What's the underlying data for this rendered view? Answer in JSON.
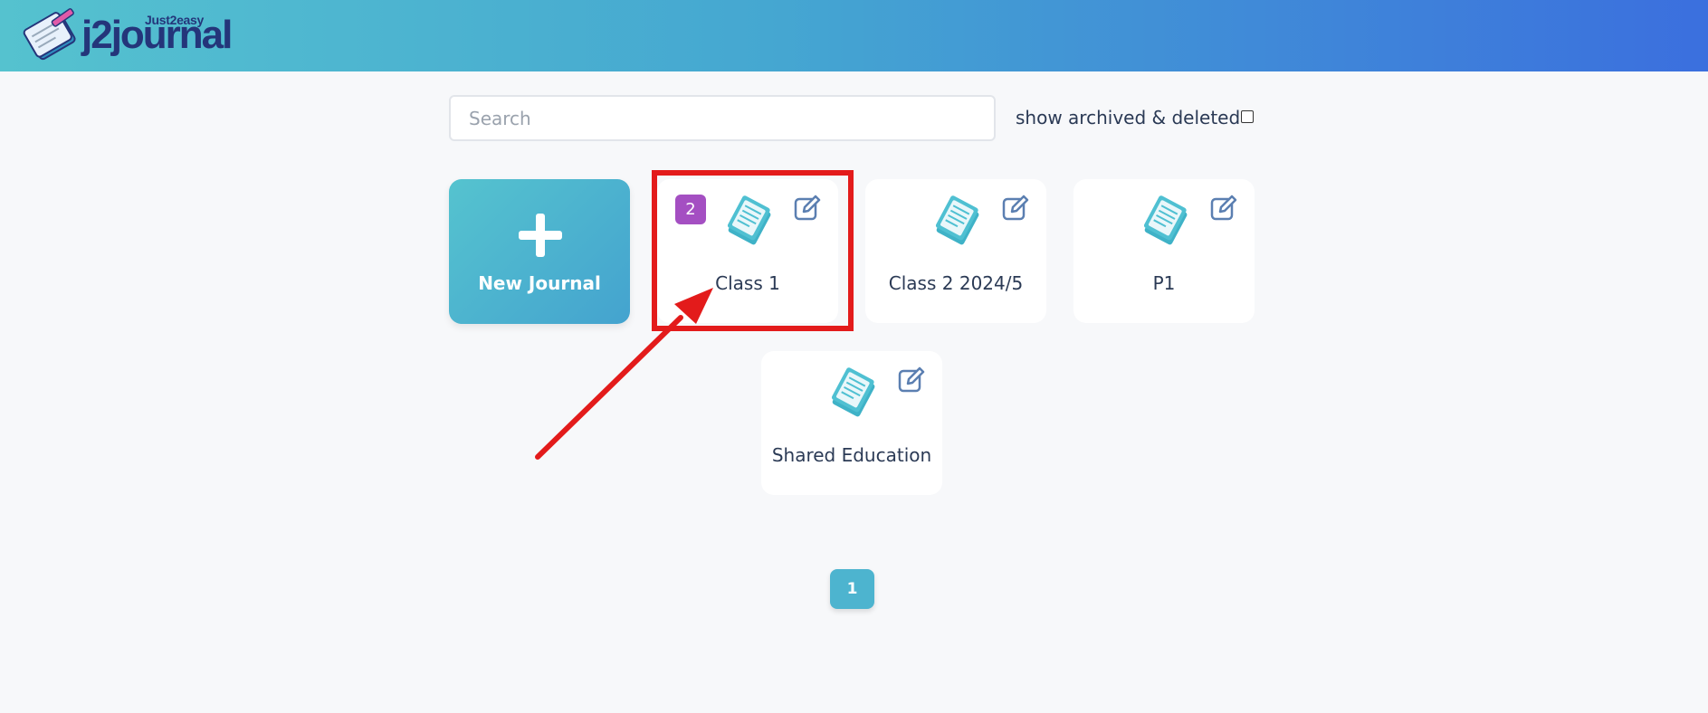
{
  "header": {
    "logo_small_text": "Just2easy",
    "logo_text": "j2journal"
  },
  "search": {
    "placeholder": "Search",
    "value": ""
  },
  "filters": {
    "archived_label": "show archived & deleted",
    "archived_checked": false
  },
  "new_journal": {
    "label": "New Journal"
  },
  "journals": [
    {
      "title": "Class 1",
      "badge": "2"
    },
    {
      "title": "Class 2 2024/5"
    },
    {
      "title": "P1"
    },
    {
      "title": "Shared Education"
    }
  ],
  "pagination": {
    "current_page": "1"
  },
  "colors": {
    "header_start": "#55c2cf",
    "header_end": "#3b6fde",
    "badge": "#a44fc2",
    "highlight": "#e31b1b",
    "accent": "#4db4cf"
  },
  "icons": {
    "journal": "journal-icon",
    "edit": "edit-icon",
    "plus": "plus-icon"
  }
}
